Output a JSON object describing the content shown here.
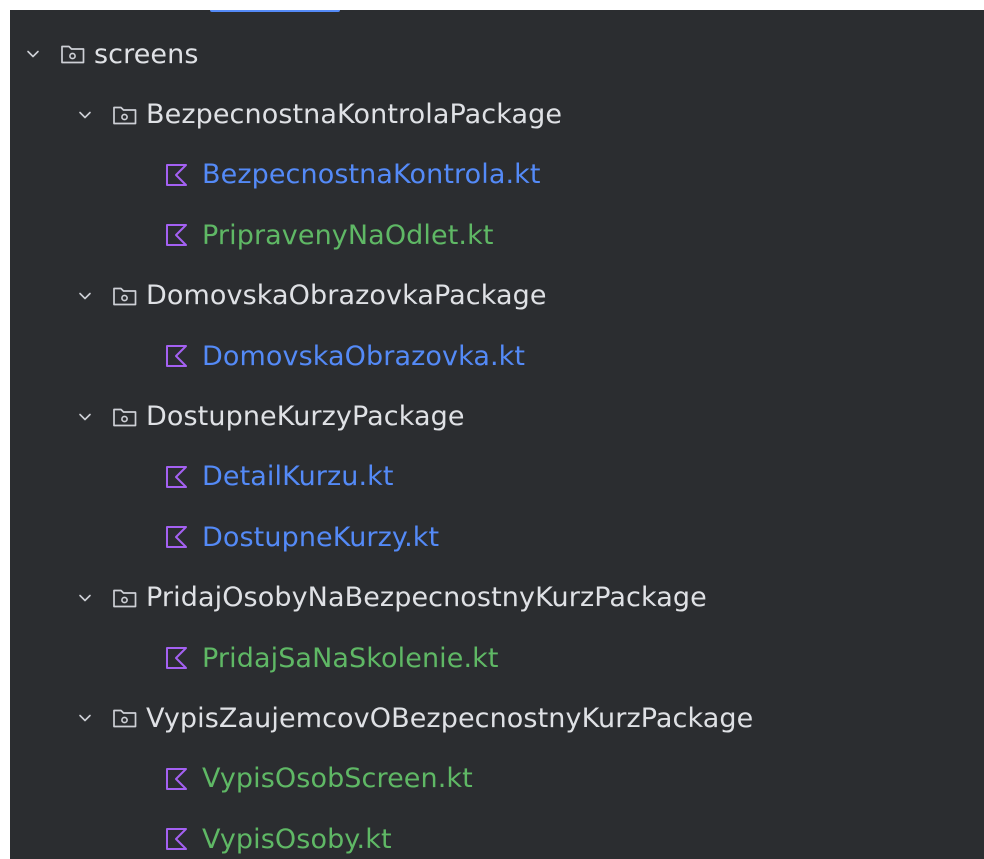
{
  "project_tree": {
    "root": {
      "label": "screens",
      "expanded": true,
      "icon": "package-folder-icon"
    },
    "packages": [
      {
        "label": "BezpecnostnaKontrolaPackage",
        "expanded": true,
        "files": [
          {
            "label": "BezpecnostnaKontrola.kt",
            "vcs_status": "modified"
          },
          {
            "label": "PripravenyNaOdlet.kt",
            "vcs_status": "added"
          }
        ]
      },
      {
        "label": "DomovskaObrazovkaPackage",
        "expanded": true,
        "files": [
          {
            "label": "DomovskaObrazovka.kt",
            "vcs_status": "modified"
          }
        ]
      },
      {
        "label": "DostupneKurzyPackage",
        "expanded": true,
        "files": [
          {
            "label": "DetailKurzu.kt",
            "vcs_status": "modified"
          },
          {
            "label": "DostupneKurzy.kt",
            "vcs_status": "modified"
          }
        ]
      },
      {
        "label": "PridajOsobyNaBezpecnostnyKurzPackage",
        "expanded": true,
        "files": [
          {
            "label": "PridajSaNaSkolenie.kt",
            "vcs_status": "added"
          }
        ]
      },
      {
        "label": "VypisZaujemcovOBezpecnostnyKurzPackage",
        "expanded": true,
        "files": [
          {
            "label": "VypisOsobScreen.kt",
            "vcs_status": "added"
          },
          {
            "label": "VypisOsoby.kt",
            "vcs_status": "added"
          }
        ]
      }
    ]
  },
  "colors": {
    "panel_background": "#2b2d30",
    "default_text": "#dfe1e5",
    "modified_text": "#548af7",
    "added_text": "#5fb865",
    "kotlin_icon": "#a461f2",
    "icon_gray": "#ced0d6"
  }
}
